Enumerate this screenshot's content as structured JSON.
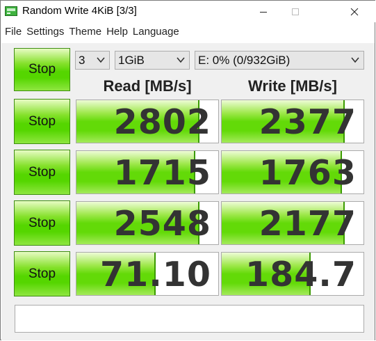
{
  "window": {
    "title": "Random Write 4KiB [3/3]",
    "icon": "green-disk-icon"
  },
  "menu": [
    "File",
    "Settings",
    "Theme",
    "Help",
    "Language"
  ],
  "controls": {
    "count": "3",
    "size": "1GiB",
    "drive": "E: 0% (0/932GiB)"
  },
  "headers": {
    "read": "Read [MB/s]",
    "write": "Write [MB/s]"
  },
  "rows": [
    {
      "button": "Stop",
      "read": "2802",
      "write": "2377",
      "read_fill": 0.86,
      "write_fill": 0.86
    },
    {
      "button": "Stop",
      "read": "1715",
      "write": "1763",
      "read_fill": 0.83,
      "write_fill": 0.84
    },
    {
      "button": "Stop",
      "read": "2548",
      "write": "2177",
      "read_fill": 0.86,
      "write_fill": 0.86
    },
    {
      "button": "Stop",
      "read": "71.10",
      "write": "184.7",
      "read_fill": 0.55,
      "write_fill": 0.62
    }
  ],
  "all_button": "Stop",
  "comment": "",
  "colors": {
    "accent_green": "#55d600",
    "text_value": "#333333"
  }
}
